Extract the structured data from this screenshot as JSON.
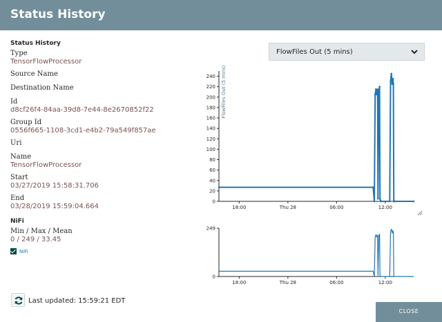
{
  "dialog": {
    "title": "Status History",
    "close_label": "CLOSE"
  },
  "details": {
    "section_title": "Status History",
    "type_label": "Type",
    "type_value": "TensorFlowProcessor",
    "source_label": "Source Name",
    "destination_label": "Destination Name",
    "id_label": "Id",
    "id_value": "d8cf26f4-84aa-39d8-7e44-8e2670852f22",
    "group_label": "Group Id",
    "group_value": "0556f665-1108-3cd1-e4b2-79a549f857ae",
    "uri_label": "Uri",
    "name_label": "Name",
    "name_value": "TensorFlowProcessor",
    "start_label": "Start",
    "start_value": "03/27/2019 15:58:31.706",
    "end_label": "End",
    "end_value": "03/28/2019 15:59:04.664"
  },
  "nifi": {
    "section_title": "NiFi",
    "mmm_label": "Min / Max / Mean",
    "mmm_value": "0 / 249 / 33.45",
    "legend_label": "NiFi",
    "legend_checked": true
  },
  "metric_select": {
    "selected": "FlowFiles Out (5 mins)"
  },
  "footer": {
    "last_updated_label": "Last updated:",
    "last_updated_value": "15:59:21 EDT"
  },
  "colors": {
    "header": "#728e9b",
    "line": "#1f77b4",
    "value_text": "#775351",
    "button": "#728e9b"
  },
  "icons": {
    "dropdown": "chevron-down-icon",
    "refresh": "refresh-icon",
    "checkbox": "check-icon"
  },
  "chart_data": [
    {
      "type": "line",
      "ylabel": "FlowFiles Out (5 mins)",
      "ylim": [
        0,
        250
      ],
      "yticks": [
        0,
        20,
        40,
        60,
        80,
        100,
        120,
        140,
        160,
        180,
        200,
        220,
        240
      ],
      "xlim": [
        0,
        24
      ],
      "xticks": [
        {
          "x": 2.5,
          "label": "18:00"
        },
        {
          "x": 8.5,
          "label": "Thu 28"
        },
        {
          "x": 14.5,
          "label": "06:00"
        },
        {
          "x": 20.5,
          "label": "12:00"
        }
      ],
      "series": [
        {
          "x": [
            0,
            19.0,
            19.15,
            19.25,
            19.35,
            19.45,
            19.55,
            19.6,
            19.7,
            19.8,
            19.85,
            19.95,
            20.0,
            21.05,
            21.15,
            21.25,
            21.35,
            21.45,
            21.5,
            21.55,
            21.65,
            21.7,
            24
          ],
          "y": [
            27,
            27,
            0,
            205,
            215,
            205,
            215,
            5,
            210,
            220,
            5,
            0,
            0,
            0,
            230,
            245,
            225,
            235,
            225,
            0,
            0,
            0,
            0
          ]
        }
      ]
    },
    {
      "type": "line",
      "ylim": [
        0,
        249
      ],
      "yticks": [
        0,
        249
      ],
      "xlim": [
        0,
        24
      ],
      "xticks": [
        {
          "x": 2.5,
          "label": "18:00"
        },
        {
          "x": 8.5,
          "label": "Thu 28"
        },
        {
          "x": 14.5,
          "label": "06:00"
        },
        {
          "x": 20.5,
          "label": "12:00"
        }
      ],
      "series": [
        {
          "x": [
            0,
            19.0,
            19.15,
            19.25,
            19.35,
            19.45,
            19.55,
            19.6,
            19.7,
            19.8,
            19.85,
            19.95,
            20.0,
            21.05,
            21.15,
            21.25,
            21.35,
            21.45,
            21.5,
            21.55,
            21.65,
            21.7,
            24
          ],
          "y": [
            27,
            27,
            0,
            205,
            215,
            205,
            215,
            5,
            210,
            220,
            5,
            0,
            0,
            0,
            230,
            245,
            225,
            235,
            225,
            0,
            0,
            0,
            0
          ]
        }
      ]
    }
  ]
}
